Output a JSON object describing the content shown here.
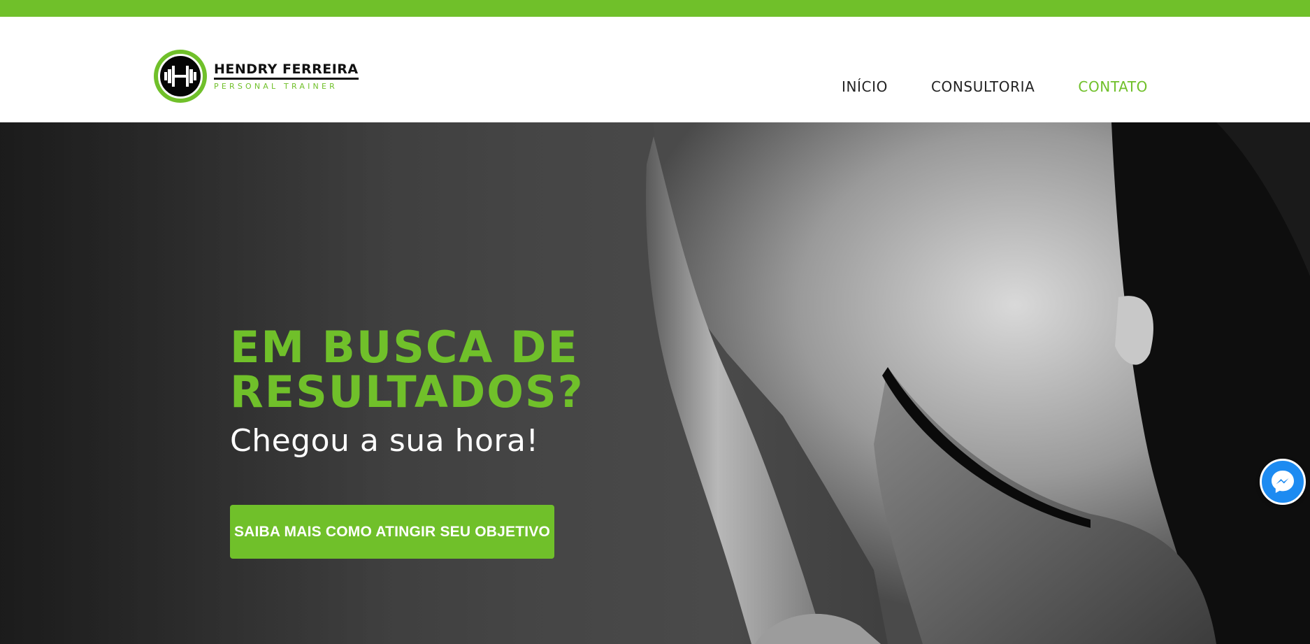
{
  "brand": {
    "name": "HENDRY FERREIRA",
    "tagline": "PERSONAL TRAINER",
    "logo_icon": "dumbbell-h-icon",
    "accent_color": "#70c02a"
  },
  "nav": {
    "items": [
      {
        "label": "INÍCIO",
        "active": false
      },
      {
        "label": "CONSULTORIA",
        "active": false
      },
      {
        "label": "CONTATO",
        "active": true
      }
    ]
  },
  "hero": {
    "title": "EM BUSCA DE\nRESULTADOS?",
    "subtitle": "Chegou a sua hora!",
    "cta_label": "SAIBA MAIS COMO ATINGIR SEU OBJETIVO",
    "background": "grayscale-athlete-photo"
  },
  "floating": {
    "messenger_icon": "messenger-icon",
    "messenger_color": "#1d8bf1"
  }
}
